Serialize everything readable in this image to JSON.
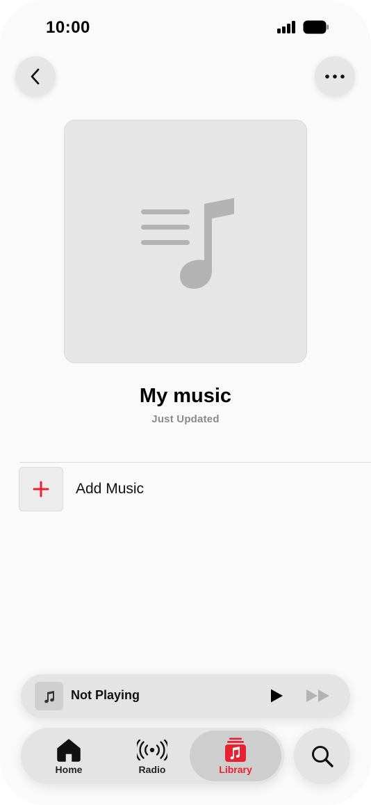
{
  "status_bar": {
    "time": "10:00"
  },
  "header": {
    "back_icon": "chevron-left-icon",
    "more_icon": "ellipsis-icon"
  },
  "playlist": {
    "title": "My music",
    "subtitle": "Just Updated",
    "artwork_icon": "music-list-icon"
  },
  "actions": {
    "add_music_label": "Add Music",
    "add_icon": "plus-icon"
  },
  "mini_player": {
    "title": "Not Playing",
    "play_icon": "play-icon",
    "forward_icon": "fast-forward-icon"
  },
  "tabs": [
    {
      "label": "Home",
      "icon": "house-icon",
      "selected": false
    },
    {
      "label": "Radio",
      "icon": "radio-waves-icon",
      "selected": false
    },
    {
      "label": "Library",
      "icon": "library-icon",
      "selected": true
    }
  ],
  "search": {
    "icon": "search-icon"
  },
  "colors": {
    "accent": "#e8202f",
    "surface": "#e4e4e4",
    "artwork_glyph": "#b3b3b3"
  }
}
